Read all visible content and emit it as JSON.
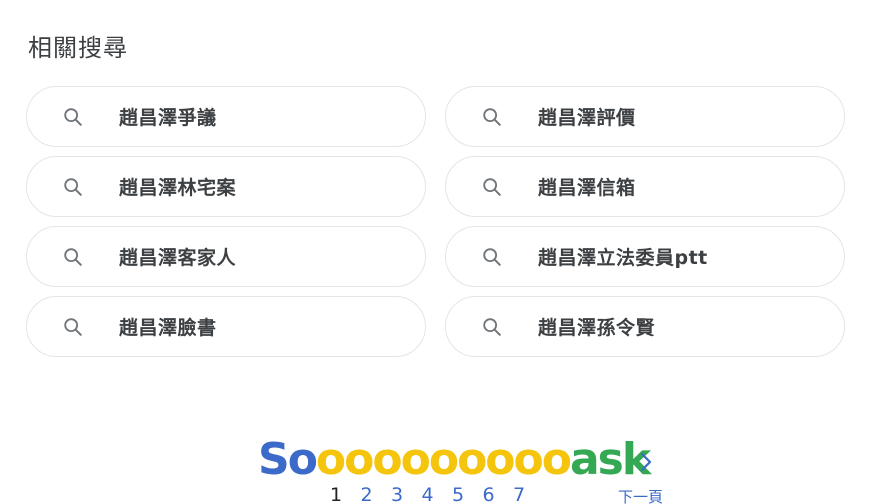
{
  "related": {
    "title": "相關搜尋",
    "items": [
      {
        "label": "趙昌澤爭議"
      },
      {
        "label": "趙昌澤評價"
      },
      {
        "label": "趙昌澤林宅案"
      },
      {
        "label": "趙昌澤信箱"
      },
      {
        "label": "趙昌澤客家人"
      },
      {
        "label": "趙昌澤立法委員ptt"
      },
      {
        "label": "趙昌澤臉書"
      },
      {
        "label": "趙昌澤孫令賢"
      }
    ],
    "icon": "search-icon"
  },
  "pagination": {
    "logo": {
      "prefix": "So",
      "middle": "ooooooooo",
      "suffix": "ask"
    },
    "pages": [
      "1",
      "2",
      "3",
      "4",
      "5",
      "6",
      "7"
    ],
    "current_page": "1",
    "next_label": "下一頁",
    "next_icon": "chevron-right-icon"
  },
  "colors": {
    "logo_blue": "#3b6ac9",
    "logo_yellow": "#f5c40c",
    "logo_green": "#34a853",
    "link": "#3b6ac9"
  }
}
